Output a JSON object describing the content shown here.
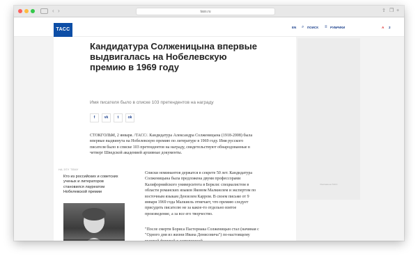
{
  "browser": {
    "url": "tass.ru",
    "icons": [
      "traffic-lights",
      "sidebar-icon",
      "back-arrow-icon",
      "forward-arrow-icon",
      "share-icon",
      "tabs-icon",
      "plus-icon"
    ]
  },
  "header": {
    "logo": "ТАСС",
    "lang": "EN",
    "search_label": "ПОИСК",
    "sections_label": "РУБРИКИ",
    "extra_badge": "2"
  },
  "article": {
    "headline": "Кандидатура Солженицына впервые выдвигалась на Нобелевскую премию в 1969 году",
    "lead": "Имя писателя было в списке 103 претендентов на награду",
    "share_buttons": [
      "f",
      "vk",
      "t",
      "ok"
    ],
    "paragraph1": "СТОКГОЛЬМ, 2 января. /ТАСС/. Кандидатура Александра Солженицына (1918-2008) была впервые выдвинута на Нобелевскую премию по литературе в 1969 году. Имя русского писателя было в списке 103 претендентов на награду, свидетельствуют обнародованные в четверг Шведской академией архивные документы.",
    "paragraph2": "Списки номинантов держатся в секрете 50 лет. Кандидатура Солженицына была предложена двумя профессорами Калифорнийского университета в Беркли: специалистом в области романских языков Яковом Малкиелем и экспертом по восточным языкам Дензелем Карром. В своем письме от 9 января 1969 года Малкиель отмечает, что премию следует присудить писателю не за какое-то отдельно взятое произведение, а за все его творчество.",
    "paragraph3": "\"После смерти Бориса Пастернака Солженицын стал (начиная с \"Одного дня из жизни Ивана Денисовича\") по-настоящему великой фигурой в современной"
  },
  "related": {
    "label": "НА ЭТУ ТЕМУ",
    "title": "Кто из российских и советских ученых и литераторов становился лауреатом Нобелевской премии"
  },
  "sidebar": {
    "ad_caption": "Реклама на ТАСС"
  }
}
